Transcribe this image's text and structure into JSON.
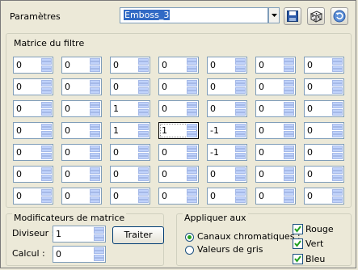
{
  "header": {
    "params_label": "Paramètres",
    "preset_value": "Emboss_3",
    "icons": [
      "save-icon",
      "randomize-dice-icon",
      "reset-icon"
    ]
  },
  "matrix": {
    "title": "Matrice du filtre",
    "rows": [
      [
        "0",
        "0",
        "0",
        "0",
        "0",
        "0",
        "0"
      ],
      [
        "0",
        "0",
        "0",
        "0",
        "0",
        "0",
        "0"
      ],
      [
        "0",
        "0",
        "1",
        "0",
        "0",
        "0",
        "0"
      ],
      [
        "0",
        "0",
        "1",
        "1",
        "-1",
        "0",
        "0"
      ],
      [
        "0",
        "0",
        "0",
        "0",
        "-1",
        "0",
        "0"
      ],
      [
        "0",
        "0",
        "0",
        "0",
        "0",
        "0",
        "0"
      ],
      [
        "0",
        "0",
        "0",
        "0",
        "0",
        "0",
        "0"
      ]
    ]
  },
  "modifiers": {
    "title": "Modificateurs de matrice",
    "divisor_label": "Diviseur :",
    "divisor_value": "1",
    "bias_label": "Calcul :",
    "bias_value": "0",
    "process_button": "Traiter"
  },
  "apply": {
    "title": "Appliquer aux",
    "radio_color": "Canaux chromatiques :",
    "radio_gray": "Valeurs de gris",
    "selected": "color",
    "check_red": "Rouge",
    "check_green": "Vert",
    "check_blue": "Bleu"
  }
}
